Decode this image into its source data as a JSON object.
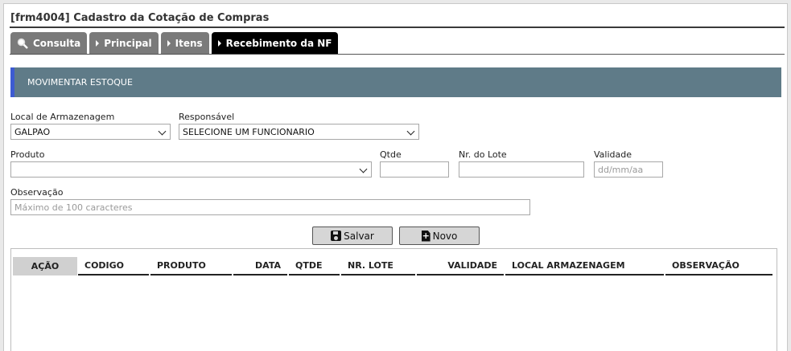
{
  "window": {
    "title": "[frm4004] Cadastro da Cotação de Compras"
  },
  "tabs": [
    {
      "label": "Consulta",
      "icon": "search-icon"
    },
    {
      "label": "Principal",
      "icon": "triangle-right-icon"
    },
    {
      "label": "Itens",
      "icon": "triangle-right-icon"
    },
    {
      "label": "Recebimento da NF",
      "icon": "triangle-right-icon",
      "active": true
    }
  ],
  "section": {
    "title": "MOVIMENTAR ESTOQUE"
  },
  "form": {
    "local_label": "Local de Armazenagem",
    "local_value": "GALPAO",
    "responsavel_label": "Responsável",
    "responsavel_value": "SELECIONE UM FUNCIONARIO",
    "produto_label": "Produto",
    "produto_value": "",
    "qtde_label": "Qtde",
    "qtde_value": "",
    "lote_label": "Nr. do Lote",
    "lote_value": "",
    "validade_label": "Validade",
    "validade_placeholder": "dd/mm/aa",
    "obs_label": "Observação",
    "obs_placeholder": "Máximo de 100 caracteres"
  },
  "buttons": {
    "save_label": "Salvar",
    "new_label": "Novo"
  },
  "table": {
    "columns": [
      "AÇÃO",
      "CODIGO",
      "PRODUTO",
      "DATA",
      "QTDE",
      "NR. LOTE",
      "VALIDADE",
      "LOCAL ARMAZENAGEM",
      "OBSERVAÇÃO"
    ],
    "rows": []
  },
  "colors": {
    "section_bg": "#5f7b88",
    "section_accent": "#3d5bd1",
    "tab_active": "#000000",
    "tab_inactive": "#7a7a7a"
  }
}
